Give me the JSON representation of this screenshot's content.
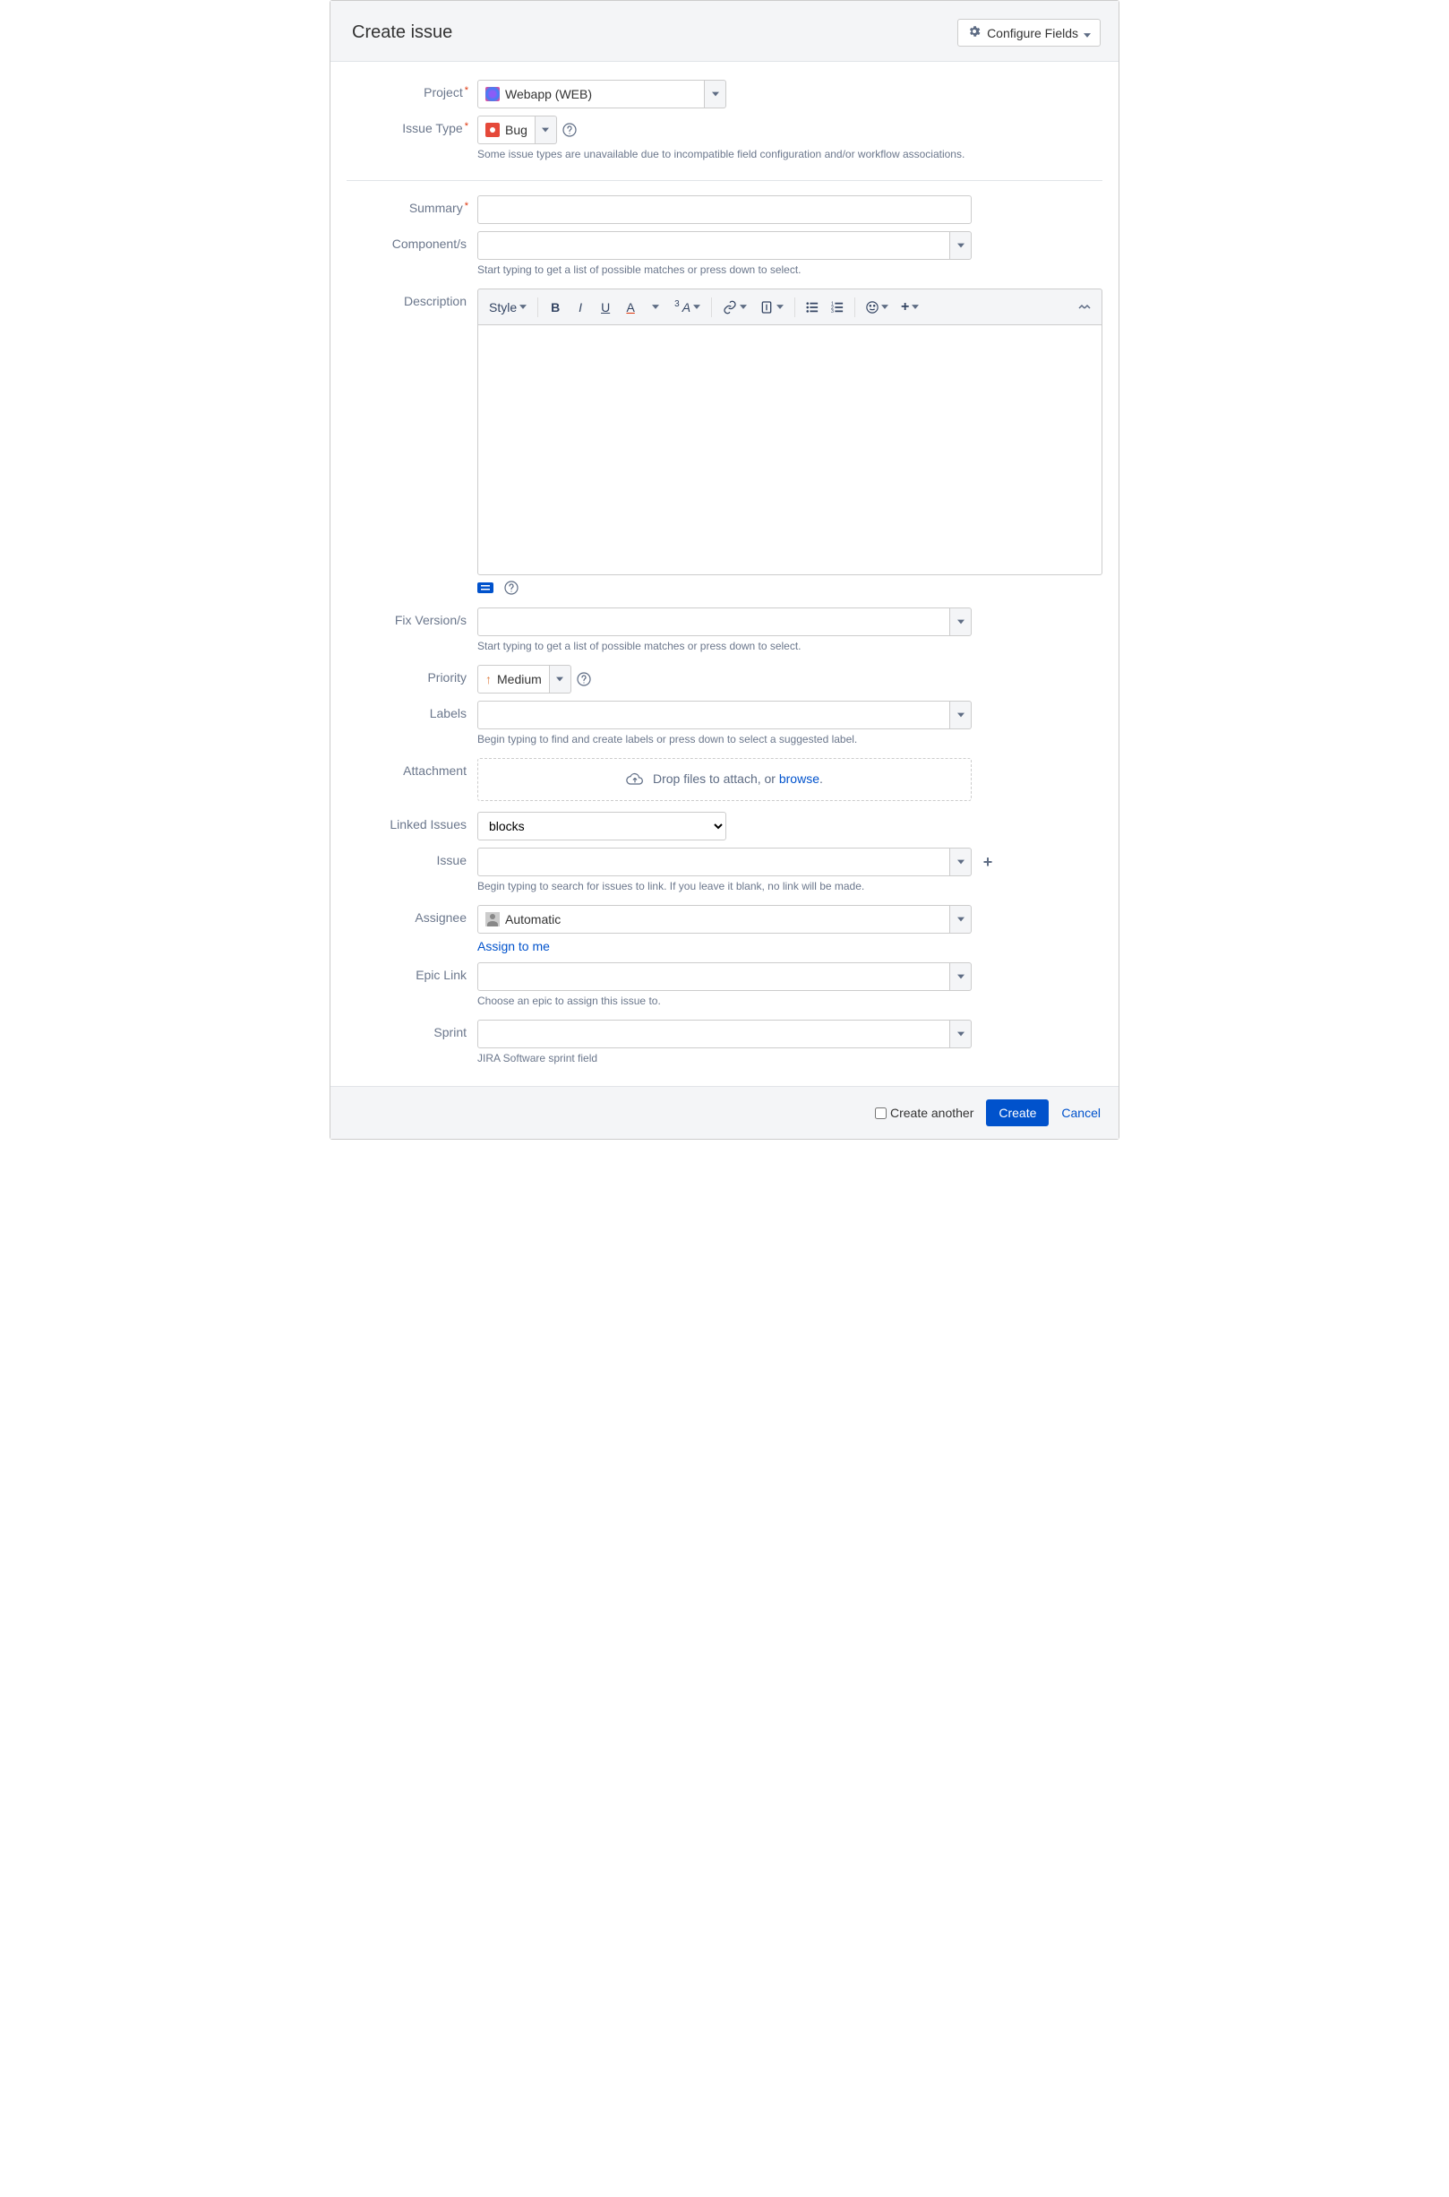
{
  "header": {
    "title": "Create issue",
    "configure_label": "Configure Fields"
  },
  "fields": {
    "project": {
      "label": "Project",
      "value": "Webapp (WEB)"
    },
    "issue_type": {
      "label": "Issue Type",
      "value": "Bug",
      "helper": "Some issue types are unavailable due to incompatible field configuration and/or workflow associations."
    },
    "summary": {
      "label": "Summary"
    },
    "components": {
      "label": "Component/s",
      "helper": "Start typing to get a list of possible matches or press down to select."
    },
    "description": {
      "label": "Description",
      "style_label": "Style"
    },
    "fix_versions": {
      "label": "Fix Version/s",
      "helper": "Start typing to get a list of possible matches or press down to select."
    },
    "priority": {
      "label": "Priority",
      "value": "Medium"
    },
    "labels": {
      "label": "Labels",
      "helper": "Begin typing to find and create labels or press down to select a suggested label."
    },
    "attachment": {
      "label": "Attachment",
      "drop_text": "Drop files to attach, or ",
      "browse": "browse"
    },
    "linked_issues": {
      "label": "Linked Issues",
      "value": "blocks"
    },
    "issue": {
      "label": "Issue",
      "helper": "Begin typing to search for issues to link. If you leave it blank, no link will be made."
    },
    "assignee": {
      "label": "Assignee",
      "value": "Automatic",
      "assign_to_me": "Assign to me"
    },
    "epic_link": {
      "label": "Epic Link",
      "helper": "Choose an epic to assign this issue to."
    },
    "sprint": {
      "label": "Sprint",
      "helper": "JIRA Software sprint field"
    }
  },
  "footer": {
    "create_another": "Create another",
    "create": "Create",
    "cancel": "Cancel"
  }
}
